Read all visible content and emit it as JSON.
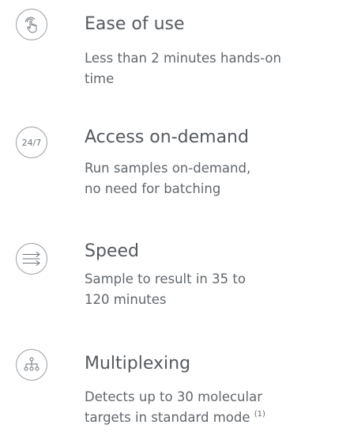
{
  "features": [
    {
      "icon": "hand-pointer-icon",
      "title": "Ease of use",
      "desc_line1": "Less than 2 minutes hands-on",
      "desc_line2": "time"
    },
    {
      "icon": "24-7-icon",
      "icon_text": "24/7",
      "title": "Access on-demand",
      "desc_line1": "Run samples on-demand,",
      "desc_line2": "no need for batching"
    },
    {
      "icon": "arrows-right-icon",
      "title": "Speed",
      "desc_line1": "Sample to result in 35 to",
      "desc_line2": "120 minutes"
    },
    {
      "icon": "hierarchy-icon",
      "title": "Multiplexing",
      "desc_line1": "Detects up to 30 molecular",
      "desc_line2": "targets in standard mode",
      "footnote": "(1)"
    }
  ]
}
